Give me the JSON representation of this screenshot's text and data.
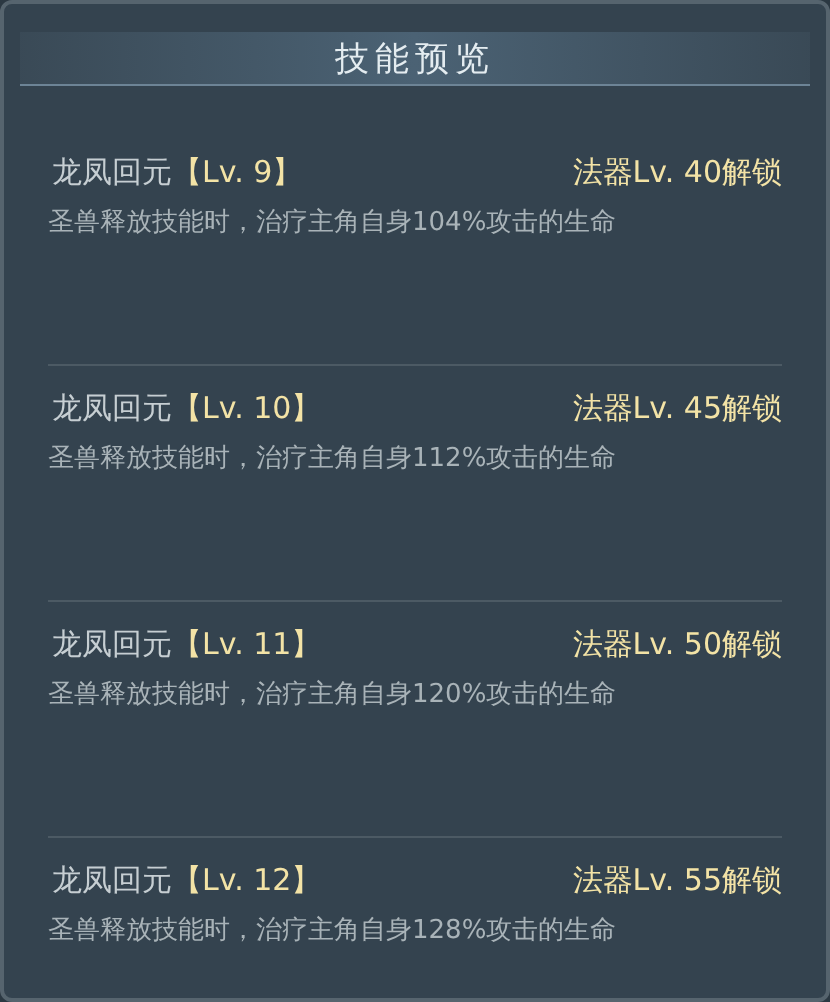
{
  "title": "技能预览",
  "skills": [
    {
      "name": "龙凤回元",
      "level": "【Lv. 9】",
      "unlock": "法器Lv. 40解锁",
      "description": "圣兽释放技能时，治疗主角自身104%攻击的生命"
    },
    {
      "name": "龙凤回元",
      "level": "【Lv. 10】",
      "unlock": "法器Lv. 45解锁",
      "description": "圣兽释放技能时，治疗主角自身112%攻击的生命"
    },
    {
      "name": "龙凤回元",
      "level": "【Lv. 11】",
      "unlock": "法器Lv. 50解锁",
      "description": "圣兽释放技能时，治疗主角自身120%攻击的生命"
    },
    {
      "name": "龙凤回元",
      "level": "【Lv. 12】",
      "unlock": "法器Lv. 55解锁",
      "description": "圣兽释放技能时，治疗主角自身128%攻击的生命"
    }
  ]
}
